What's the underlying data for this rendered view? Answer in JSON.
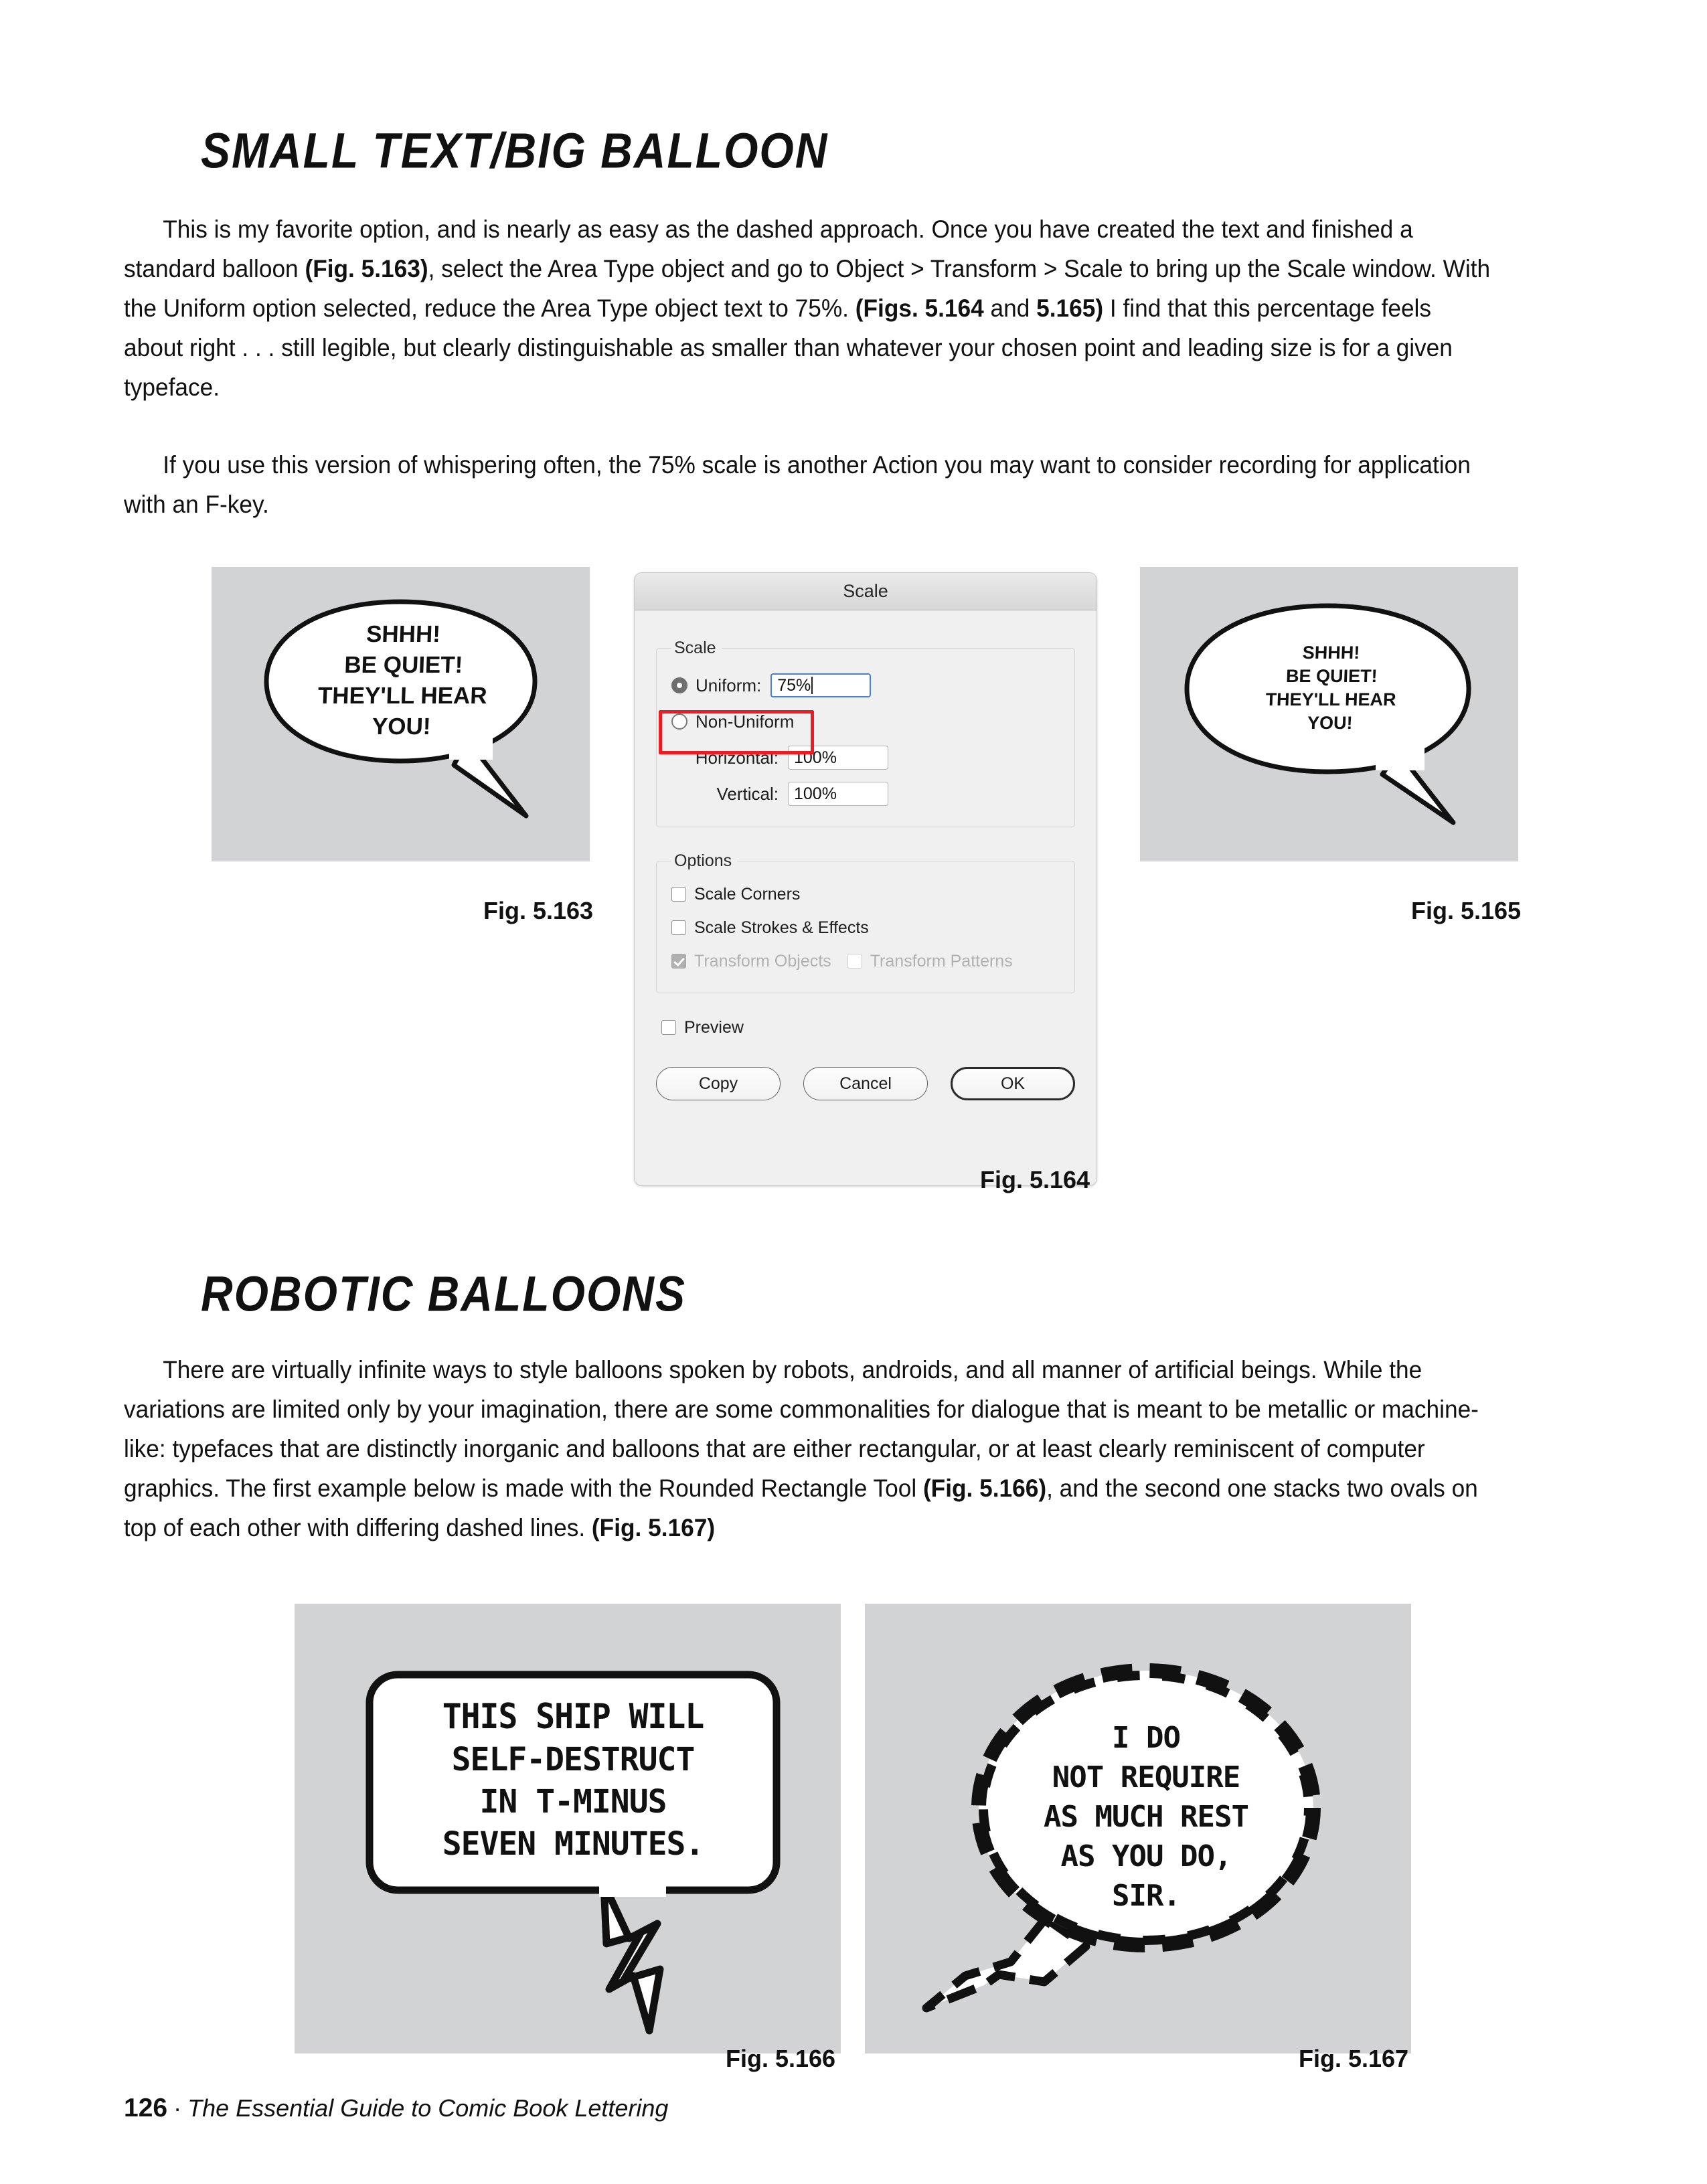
{
  "page": {
    "number": "126",
    "separator": "·",
    "book_title": "The Essential Guide to Comic Book Lettering"
  },
  "sections": [
    {
      "heading": "SMALL TEXT/BIG BALLOON",
      "paragraphs": [
        "This is my favorite option, and is nearly as easy as the dashed approach. Once you have created the text and finished a standard balloon (Fig. 5.163), select the Area Type object and go to Object > Transform > Scale to bring up the Scale window. With the Uniform option selected, reduce the Area Type object text to 75%. (Figs. 5.164 and 5.165) I find that this percentage feels about right . . . still legible, but clearly distinguishable as smaller than whatever your chosen point and leading size is for a given typeface.",
        "If you use this version of whispering often, the 75% scale is another Action you may want to consider recording for application with an F-key."
      ]
    },
    {
      "heading": "ROBOTIC BALLOONS",
      "paragraphs": [
        "There are virtually infinite ways to style balloons spoken by robots, androids, and all manner of artificial beings. While the variations are limited only by your imagination, there are some commonalities for dialogue that is meant to be metallic or machine-like: typefaces that are distinctly inorganic and balloons that are either rectangular, or at least clearly reminiscent of computer graphics. The first example below is made with the Rounded Rectangle Tool (Fig. 5.166), and the second one stacks two ovals on top of each other with differing dashed lines. (Fig. 5.167)"
      ]
    }
  ],
  "figures": {
    "fig_5_163": {
      "caption": "Fig. 5.163",
      "balloon_lines": [
        "SHHH!",
        "BE QUIET!",
        "THEY'LL HEAR",
        "YOU!"
      ],
      "style": "oval-speech-balloon"
    },
    "fig_5_164": {
      "caption": "Fig. 5.164"
    },
    "fig_5_165": {
      "caption": "Fig. 5.165",
      "balloon_lines": [
        "SHHH!",
        "BE QUIET!",
        "THEY'LL HEAR",
        "YOU!"
      ],
      "style": "oval-speech-balloon-small-text"
    },
    "fig_5_166": {
      "caption": "Fig. 5.166",
      "balloon_lines": [
        "THIS SHIP WILL",
        "SELF-DESTRUCT",
        "IN T-MINUS",
        "SEVEN MINUTES."
      ],
      "style": "rounded-rectangle-balloon"
    },
    "fig_5_167": {
      "caption": "Fig. 5.167",
      "balloon_lines": [
        "I DO",
        "NOT REQUIRE",
        "AS MUCH REST",
        "AS YOU DO,",
        "SIR."
      ],
      "style": "dashed-oval-balloon"
    }
  },
  "dialog": {
    "title": "Scale",
    "scale_group": {
      "legend": "Scale",
      "uniform": {
        "label": "Uniform:",
        "selected": true,
        "value": "75%"
      },
      "non_uniform": {
        "label": "Non-Uniform",
        "selected": false
      },
      "horizontal": {
        "label": "Horizontal:",
        "value": "100%"
      },
      "vertical": {
        "label": "Vertical:",
        "value": "100%"
      }
    },
    "options_group": {
      "legend": "Options",
      "items": [
        {
          "label": "Scale Corners",
          "checked": false,
          "disabled": false
        },
        {
          "label": "Scale Strokes & Effects",
          "checked": false,
          "disabled": false
        },
        {
          "label": "Transform Objects",
          "checked": true,
          "disabled": true
        },
        {
          "label": "Transform Patterns",
          "checked": false,
          "disabled": true
        }
      ]
    },
    "preview": {
      "label": "Preview",
      "checked": false
    },
    "buttons": {
      "copy": "Copy",
      "cancel": "Cancel",
      "ok": "OK"
    },
    "highlight_color": "#ec1c24"
  },
  "colors": {
    "figure_panel_bg": "#d2d3d5",
    "dialog_bg": "#f0f0f0",
    "text": "#111111",
    "accent_red": "#ec1c24"
  }
}
